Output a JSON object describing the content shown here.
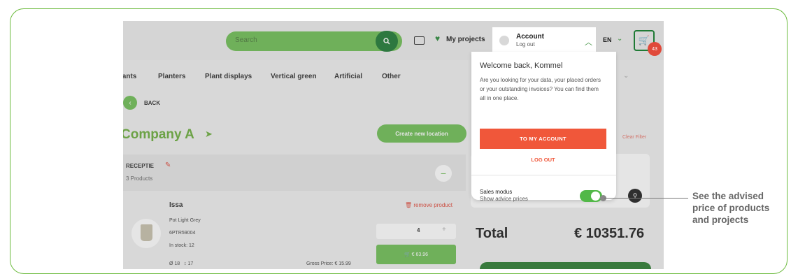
{
  "colors": {
    "brand_green": "#6cae3e",
    "dark_green": "#1f7a35",
    "accent_red": "#f0573a",
    "frame": "#6dbb3f"
  },
  "header": {
    "search_placeholder": "Search",
    "my_projects": "My projects",
    "account": {
      "title": "Account",
      "subtitle": "Log out"
    },
    "language": "EN",
    "cart_count": "43"
  },
  "nav": {
    "items": [
      "lants",
      "Planters",
      "Plant displays",
      "Vertical green",
      "Artificial",
      "Other"
    ]
  },
  "back_label": "BACK",
  "company": {
    "name": "Company A",
    "create_button": "Create new location",
    "clear_filter": "Clear Filter"
  },
  "location": {
    "name": "RECEPTIE",
    "count": "3 Products"
  },
  "product": {
    "name": "Issa",
    "remove": "remove product",
    "description": "Pot Light Grey",
    "sku": "6PTR59004",
    "stock": "In stock: 12",
    "quantity": "4",
    "price_button": "€ 63.96",
    "gross_price": "Gross Price: € 15.99",
    "diameter": "Ø 18",
    "height": "↕ 17"
  },
  "total": {
    "label": "Total",
    "value": "€ 10351.76"
  },
  "dropdown": {
    "welcome": "Welcome back, Kommel",
    "description": "Are you looking for your data, your placed orders or your outstanding invoices? You can find them all in one place.",
    "to_account": "TO MY ACCOUNT",
    "logout": "LOG OUT",
    "sales_title": "Sales modus",
    "sales_subtitle": "Show advice prices",
    "sales_toggle_on": true
  },
  "callout": "See the advised price of products and projects"
}
